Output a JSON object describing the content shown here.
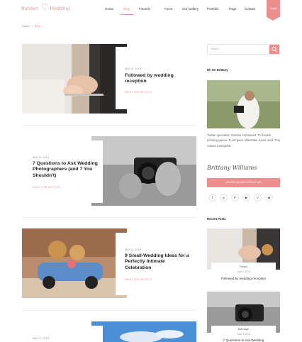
{
  "brand": {
    "name_part1": "Banner",
    "name_part2": "Wedding"
  },
  "nav": {
    "items": [
      "Home",
      "Blog",
      "Fotoinfo",
      "Favor",
      "Our Gallery",
      "Portfolio",
      "Page",
      "Contact"
    ],
    "signin_label": "Login"
  },
  "breadcrumb": {
    "home": "Home",
    "sep": "/",
    "current": "Blog"
  },
  "posts": [
    {
      "date": "MAY 8, 2019",
      "title": "Followed by wedding reception",
      "link": "READ THE ARTICLE"
    },
    {
      "date": "MAY 8, 2019",
      "title": "7 Questions to Ask Wedding Photographers (and 7 You Shouldn't)",
      "link": "READ THE ARTICLE"
    },
    {
      "date": "MAY 8, 2019",
      "title": "9 Small-Wedding Ideas for a Perfectly Intimate Celebration",
      "link": "READ THE ARTICLE"
    },
    {
      "date": "MAY 8, 2019"
    }
  ],
  "sidebar": {
    "search_placeholder": "Search ...",
    "about_title": "Hi! I'm Brittany",
    "about_text": "Twitter specialist. Zombie enthusiast. TV fanatic. Lifelong gamer. Food geek. Wannabe travel nerd. Pop culture evangelist.",
    "signature": "Brittany Williams",
    "learn_label": "LEARN MORE ABOUT ME",
    "social_icons": [
      "facebook-icon",
      "instagram-icon",
      "pinterest-icon",
      "youtube-icon",
      "vimeo-icon",
      "rss-icon"
    ],
    "recent_title": "Recent Posts",
    "recent": [
      {
        "category": "Favour",
        "date": "June 4, 2019",
        "title": "Followed by wedding reception"
      },
      {
        "category": "Marriage",
        "date": "June 4, 2019",
        "title": "7 Questions to Ask Wedding"
      }
    ]
  },
  "colors": {
    "accent": "#ee8f8f"
  }
}
